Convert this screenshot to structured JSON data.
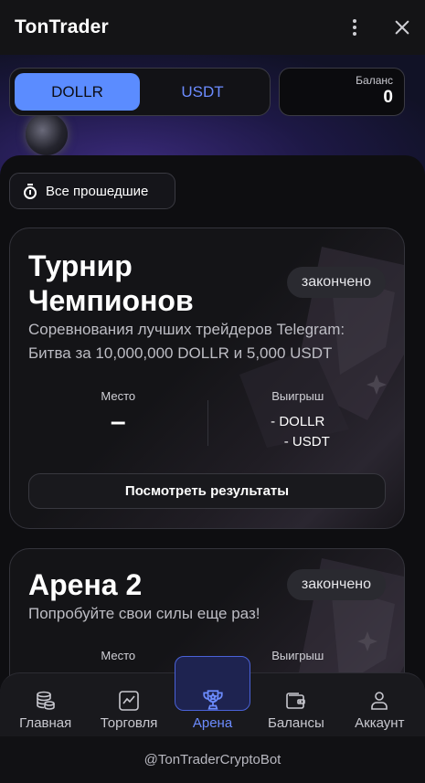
{
  "app": {
    "title": "TonTrader"
  },
  "currency": {
    "options": [
      "DOLLR",
      "USDT"
    ],
    "selected": "DOLLR"
  },
  "balance": {
    "label": "Баланс",
    "value": "0"
  },
  "filter": {
    "label": "Все прошедшие"
  },
  "tournaments": [
    {
      "title_line1": "Турнир",
      "title_line2": "Чемпионов",
      "status": "закончено",
      "description_line1": "Соревнования лучших трейдеров Telegram:",
      "description_line2": "Битва за 10,000,000 DOLLR и 5,000 USDT",
      "place_label": "Место",
      "place_value": "–",
      "prize_label": "Выигрыш",
      "prize_dollr": "- DOLLR",
      "prize_usdt": "- USDT",
      "results_button": "Посмотреть результаты"
    },
    {
      "title_line1": "Арена 2",
      "status": "закончено",
      "description_line1": "Попробуйте свои силы еще раз!",
      "place_label": "Место",
      "prize_label": "Выигрыш"
    }
  ],
  "nav": {
    "items": [
      {
        "label": "Главная",
        "icon": "coins-stack-icon"
      },
      {
        "label": "Торговля",
        "icon": "chart-line-icon"
      },
      {
        "label": "Арена",
        "icon": "trophy-icon"
      },
      {
        "label": "Балансы",
        "icon": "wallet-icon"
      },
      {
        "label": "Аккаунт",
        "icon": "user-icon"
      }
    ],
    "active": "Арена"
  },
  "footer": {
    "bot_handle": "@TonTraderCryptoBot"
  },
  "colors": {
    "accent": "#5b8cff",
    "nav_active": "#6c8cff",
    "background": "#0e0e11"
  }
}
